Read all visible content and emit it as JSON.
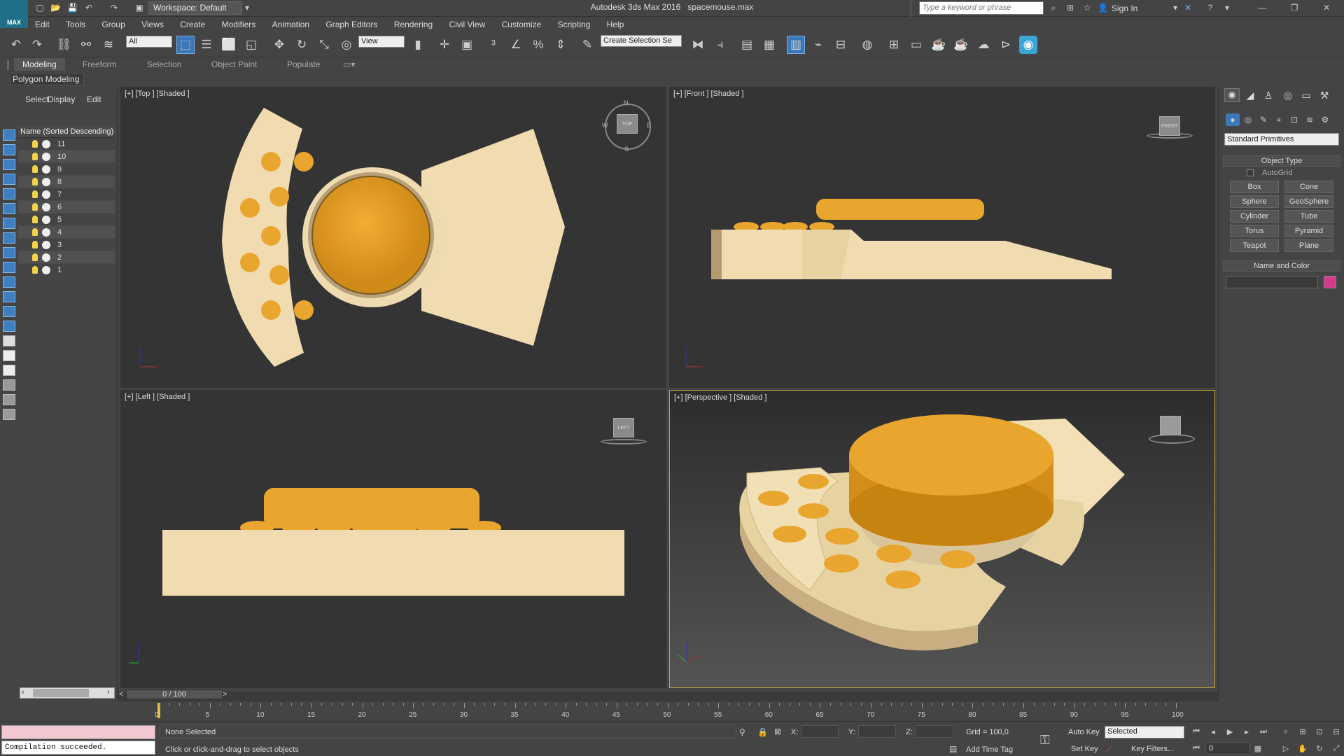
{
  "app": {
    "title": "Autodesk 3ds Max 2016",
    "file": "spacemouse.max",
    "logo": "MAX"
  },
  "titlebar": {
    "workspace": "Workspace: Default",
    "search_placeholder": "Type a keyword or phrase",
    "sign_in": "Sign In"
  },
  "menus": [
    "Edit",
    "Tools",
    "Group",
    "Views",
    "Create",
    "Modifiers",
    "Animation",
    "Graph Editors",
    "Rendering",
    "Civil View",
    "Customize",
    "Scripting",
    "Help"
  ],
  "toolbar": {
    "filter_value": "All",
    "ref_coord": "View",
    "selection_set": "Create Selection Se"
  },
  "ribbon": {
    "tabs": [
      "Modeling",
      "Freeform",
      "Selection",
      "Object Paint",
      "Populate"
    ],
    "active_tab": "Modeling",
    "sub_label": "Polygon Modeling"
  },
  "scene_explorer": {
    "tabs": [
      "Select",
      "Display",
      "Edit"
    ],
    "column_header": "Name (Sorted Descending)",
    "items": [
      "11",
      "10",
      "9",
      "8",
      "7",
      "6",
      "5",
      "4",
      "3",
      "2",
      "1"
    ]
  },
  "viewports": {
    "top": {
      "label": "[+] [Top ] [Shaded ]",
      "cube": "TOP"
    },
    "front": {
      "label": "[+] [Front ] [Shaded ]",
      "cube": "FRONT"
    },
    "left": {
      "label": "[+] [Left ] [Shaded ]",
      "cube": "LEFT"
    },
    "perspective": {
      "label": "[+] [Perspective ] [Shaded ]"
    },
    "compass": {
      "n": "N",
      "s": "S",
      "e": "E",
      "w": "W"
    }
  },
  "command_panel": {
    "category": "Standard Primitives",
    "object_type_title": "Object Type",
    "autogrid": "AutoGrid",
    "buttons": [
      "Box",
      "Cone",
      "Sphere",
      "GeoSphere",
      "Cylinder",
      "Tube",
      "Torus",
      "Pyramid",
      "Teapot",
      "Plane"
    ],
    "name_color_title": "Name and Color",
    "color_swatch": "#d4398c"
  },
  "timeline": {
    "frame_display": "0 / 100",
    "ticks": [
      "0",
      "5",
      "10",
      "15",
      "20",
      "25",
      "30",
      "35",
      "40",
      "45",
      "50",
      "55",
      "60",
      "65",
      "70",
      "75",
      "80",
      "85",
      "90",
      "95",
      "100"
    ]
  },
  "status": {
    "listener": "Compilation succeeded.",
    "selection": "None Selected",
    "prompt": "Click or click-and-drag to select objects",
    "x_label": "X:",
    "y_label": "Y:",
    "z_label": "Z:",
    "grid": "Grid = 100,0",
    "add_time_tag": "Add Time Tag",
    "auto_key": "Auto Key",
    "set_key": "Set Key",
    "key_mode": "Selected",
    "key_filters": "Key Filters...",
    "current_frame": "0"
  },
  "colors": {
    "object_beige": "#f1dfb5",
    "object_orange": "#e9a62e",
    "viewport_bg": "#343434",
    "active_border": "#c8a53a"
  }
}
